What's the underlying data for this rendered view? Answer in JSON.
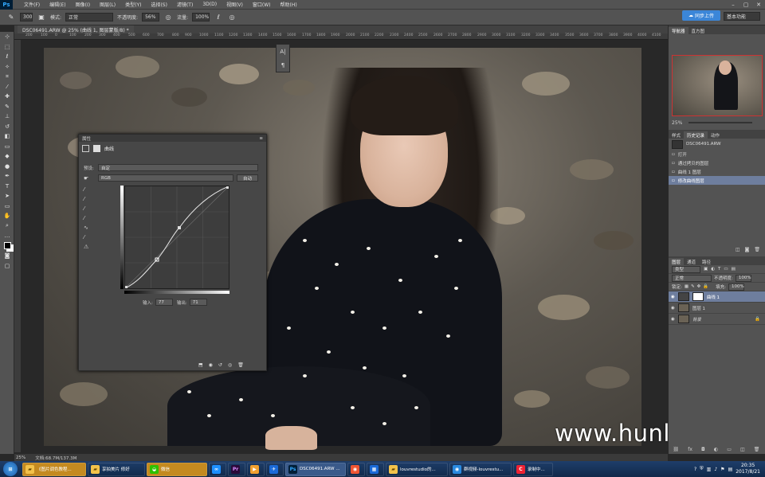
{
  "app": {
    "logo": "Ps"
  },
  "menu": [
    "文件(F)",
    "编辑(E)",
    "图像(I)",
    "图层(L)",
    "类型(Y)",
    "选择(S)",
    "滤镜(T)",
    "3D(D)",
    "视图(V)",
    "窗口(W)",
    "帮助(H)"
  ],
  "window_controls": [
    "–",
    "▢",
    "✕"
  ],
  "options": {
    "brush_size": "300",
    "mode_label": "模式:",
    "mode_value": "正常",
    "opacity_label": "不透明度:",
    "opacity_value": "56%",
    "flow_label": "流量:",
    "flow_value": "100%"
  },
  "upload_button": "同步上传",
  "workspace": "基本功能",
  "doc_tab": "DSC06491.ARW @ 25% (曲线 1, 图层蒙版/8) *",
  "ruler_labels": [
    "200",
    "100",
    "0",
    "100",
    "200",
    "300",
    "400",
    "500",
    "600",
    "700",
    "800",
    "900",
    "1000",
    "1100",
    "1200",
    "1300",
    "1400",
    "1500",
    "1600",
    "1700",
    "1800",
    "1900",
    "2000",
    "2100",
    "2200",
    "2300",
    "2400",
    "2500",
    "2600",
    "2700",
    "2800",
    "2900",
    "3000",
    "3100",
    "3200",
    "3300",
    "3400",
    "3500",
    "3600",
    "3700",
    "3800",
    "3900",
    "4000",
    "4100",
    "4200",
    "4300",
    "4400",
    "4500",
    "4600",
    "4700",
    "4800",
    "4900",
    "5000",
    "5100",
    "5200",
    "5300",
    "5400",
    "5500",
    "5600",
    "5700",
    "5800",
    "5900",
    "6000",
    "6100"
  ],
  "curves": {
    "panel_title": "属性",
    "adjust_name": "曲线",
    "preset_label": "预设:",
    "preset_value": "自定",
    "channel": "RGB",
    "auto_button": "自动",
    "input_label": "输入:",
    "input_value": "77",
    "output_label": "输出:",
    "output_value": "71"
  },
  "right_panel": {
    "nav_tabs": [
      "导航器",
      "直方图"
    ],
    "zoom": "25%",
    "history_tabs": [
      "样式",
      "历史记录",
      "动作"
    ],
    "history_doc": "DSC06491.ARW",
    "history": [
      "打开",
      "通过拷贝的图层",
      "曲线 1 图层",
      "修改曲线图层"
    ],
    "layer_tabs": [
      "图层",
      "通道",
      "路径"
    ],
    "kind_label": "类型",
    "blend_mode": "正常",
    "opacity_label": "不透明度:",
    "opacity_value": "100%",
    "lock_label": "锁定:",
    "fill_label": "填充:",
    "fill_value": "100%",
    "layers": [
      "曲线 1",
      "图层 1",
      "背景"
    ]
  },
  "status": {
    "zoom": "25%",
    "doc": "文档:68.7M/137.3M"
  },
  "taskbar": {
    "items": [
      "《图片调色教程...",
      "享拍美片 修好",
      "微信",
      "",
      "",
      "",
      "",
      "DSC06491.ARW ...",
      "",
      "",
      "louvrestudio的...",
      "群视频-louvrestu...",
      "录制中..."
    ],
    "time": "20:35",
    "date": "2017/8/21"
  },
  "watermark": "www.hunls.com",
  "colors": {
    "menubar": "#535353",
    "accent": "#31a8ff",
    "selection": "#6e7e9e",
    "taskbar": "#1e3e6a"
  }
}
